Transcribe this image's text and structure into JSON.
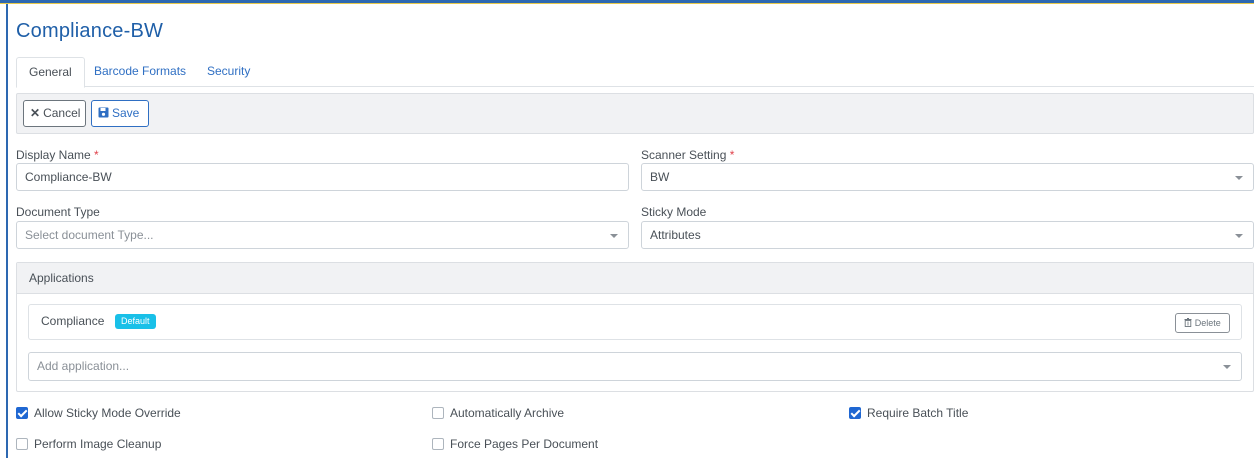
{
  "page": {
    "title": "Compliance-BW"
  },
  "tabs": [
    {
      "label": "General",
      "active": true
    },
    {
      "label": "Barcode Formats",
      "active": false
    },
    {
      "label": "Security",
      "active": false
    }
  ],
  "toolbar": {
    "cancel_label": "Cancel",
    "save_label": "Save",
    "cancel_icon": "times-icon",
    "save_icon": "floppy-disk-icon"
  },
  "form": {
    "display_name": {
      "label": "Display Name",
      "required_mark": "*",
      "value": "Compliance-BW"
    },
    "scanner_setting": {
      "label": "Scanner Setting",
      "required_mark": "*",
      "value": "BW"
    },
    "document_type": {
      "label": "Document Type",
      "placeholder": "Select document Type..."
    },
    "sticky_mode": {
      "label": "Sticky Mode",
      "value": "Attributes"
    }
  },
  "applications": {
    "heading": "Applications",
    "items": [
      {
        "name": "Compliance",
        "badge": "Default",
        "delete_label": "Delete",
        "delete_icon": "trash-icon"
      }
    ],
    "add_placeholder": "Add application..."
  },
  "options": [
    {
      "label": "Allow Sticky Mode Override",
      "checked": true
    },
    {
      "label": "Automatically Archive",
      "checked": false
    },
    {
      "label": "Require Batch Title",
      "checked": true
    },
    {
      "label": "Perform Image Cleanup",
      "checked": false
    },
    {
      "label": "Force Pages Per Document",
      "checked": false
    }
  ],
  "colors": {
    "accent": "#2f6fc3",
    "title": "#1f5fa8",
    "badge": "#19c0e8",
    "required": "#e0424b",
    "checkbox_on": "#1f67d2"
  }
}
